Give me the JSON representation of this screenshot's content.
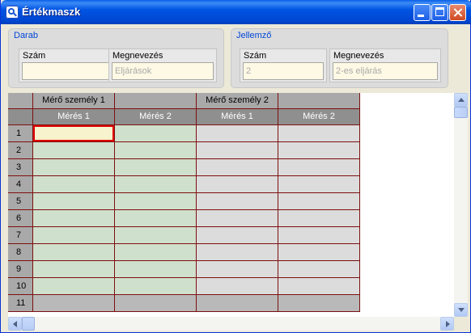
{
  "window": {
    "title": "Értékmaszk",
    "icon": "magnifier-icon"
  },
  "darab": {
    "title": "Darab",
    "szam_label": "Szám",
    "szam_value": "",
    "megnevezes_label": "Megnevezés",
    "megnevezes_value": "Eljárások"
  },
  "jellemzo": {
    "title": "Jellemző",
    "szam_label": "Szám",
    "szam_value": "2",
    "megnevezes_label": "Megnevezés",
    "megnevezes_value": "2-es eljárás"
  },
  "grid": {
    "group_headers": [
      "Mérő személy 1",
      "",
      "Mérő személy 2",
      ""
    ],
    "column_headers": [
      "Mérés 1",
      "Mérés 2",
      "Mérés 1",
      "Mérés 2"
    ],
    "row_numbers": [
      "1",
      "2",
      "3",
      "4",
      "5",
      "6",
      "7",
      "8",
      "9",
      "10",
      "11"
    ],
    "selected_row": 1,
    "selected_col": 1
  },
  "colors": {
    "title_bar": "#0054e3",
    "group_title": "#0046d5",
    "grid_border": "#7d0f0f",
    "cell_green": "#cfe0cd",
    "cell_gray": "#dcdcdc",
    "selection": "#e00000"
  }
}
